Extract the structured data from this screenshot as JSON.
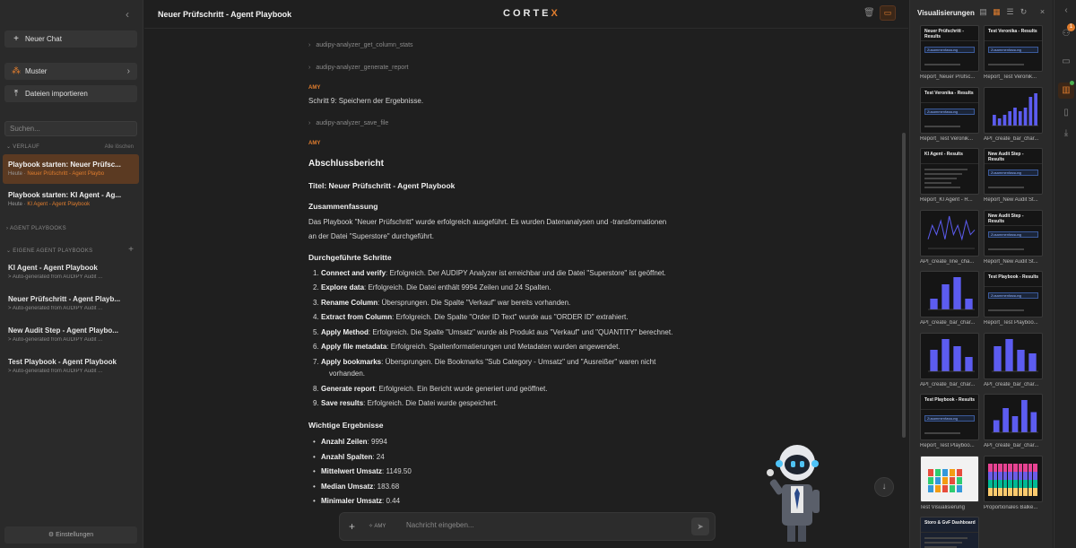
{
  "sidebar": {
    "new_chat": "Neuer Chat",
    "muster": "Muster",
    "import": "Dateien importieren",
    "search_placeholder": "Suchen...",
    "verlauf_label": "VERLAUF",
    "clear_all": "Alle löschen",
    "history": [
      {
        "title": "Playbook starten: Neuer Prüfsc...",
        "day": "Heute",
        "tag": "Neuer Prüfschritt - Agent Playbo"
      },
      {
        "title": "Playbook starten: KI Agent - Ag...",
        "day": "Heute",
        "tag": "KI Agent - Agent Playbook"
      }
    ],
    "agent_playbooks_label": "AGENT PLAYBOOKS",
    "own_playbooks_label": "EIGENE AGENT PLAYBOOKS",
    "playbooks": [
      {
        "title": "KI Agent - Agent Playbook",
        "sub": "> Auto-generated from AUDIPY Audit ..."
      },
      {
        "title": "Neuer Prüfschritt - Agent Playb...",
        "sub": "> Auto-generated from AUDIPY Audit ..."
      },
      {
        "title": "New Audit Step - Agent Playbo...",
        "sub": "> Auto-generated from AUDIPY Audit ..."
      },
      {
        "title": "Test Playbook - Agent Playbook",
        "sub": "> Auto-generated from AUDIPY Audit ..."
      }
    ],
    "settings": "Einstellungen"
  },
  "header": {
    "title": "Neuer Prüfschritt - Agent Playbook",
    "logo_a": "CORTE",
    "logo_b": "X"
  },
  "chat": {
    "tool1": "audipy-analyzer_get_column_stats",
    "tool2": "audipy-analyzer_generate_report",
    "amy": "AMY",
    "step9": "Schritt 9: Speichern der Ergebnisse.",
    "tool3": "audipy-analyzer_save_file",
    "report_heading": "Abschlussbericht",
    "report_title": "Titel: Neuer Prüfschritt - Agent Playbook",
    "summary_heading": "Zusammenfassung",
    "summary_line1": "Das Playbook \"Neuer Prüfschritt\" wurde erfolgreich ausgeführt. Es wurden Datenanalysen und -transformationen",
    "summary_line2": "an der Datei \"Superstore\" durchgeführt.",
    "steps_heading": "Durchgeführte Schritte",
    "steps": [
      {
        "n": "1.",
        "b": "Connect and verify",
        "t": ": Erfolgreich. Der AUDIPY Analyzer ist erreichbar und die Datei \"Superstore\" ist geöffnet."
      },
      {
        "n": "2.",
        "b": "Explore data",
        "t": ": Erfolgreich. Die Datei enthält 9994 Zeilen und 24 Spalten."
      },
      {
        "n": "3.",
        "b": "Rename Column",
        "t": ": Übersprungen. Die Spalte \"Verkauf\" war bereits vorhanden."
      },
      {
        "n": "4.",
        "b": "Extract from Column",
        "t": ": Erfolgreich. Die Spalte \"Order ID Text\" wurde aus \"ORDER ID\" extrahiert."
      },
      {
        "n": "5.",
        "b": "Apply Method",
        "t": ": Erfolgreich. Die Spalte \"Umsatz\" wurde als Produkt aus \"Verkauf\" und \"QUANTITY\" berechnet."
      },
      {
        "n": "6.",
        "b": "Apply file metadata",
        "t": ": Erfolgreich. Spaltenformatierungen und Metadaten wurden angewendet."
      },
      {
        "n": "7.",
        "b": "Apply bookmarks",
        "t": ": Übersprungen. Die Bookmarks \"Sub Category - Umsatz\" und \"Ausreißer\" waren nicht"
      },
      {
        "n": "",
        "b": "",
        "t": "vorhanden."
      },
      {
        "n": "8.",
        "b": "Generate report",
        "t": ": Erfolgreich. Ein Bericht wurde generiert und geöffnet."
      },
      {
        "n": "9.",
        "b": "Save results",
        "t": ": Erfolgreich. Die Datei wurde gespeichert."
      }
    ],
    "results_heading": "Wichtige Ergebnisse",
    "results": [
      {
        "b": "Anzahl Zeilen",
        "t": ": 9994"
      },
      {
        "b": "Anzahl Spalten",
        "t": ": 24"
      },
      {
        "b": "Mittelwert Umsatz",
        "t": ": 1149.50"
      },
      {
        "b": "Median Umsatz",
        "t": ": 183.68"
      },
      {
        "b": "Minimaler Umsatz",
        "t": ": 0.44"
      }
    ]
  },
  "composer": {
    "agent": "AMY",
    "placeholder": "Nachricht eingeben..."
  },
  "viz": {
    "title": "Visualisierungen",
    "items": [
      {
        "kind": "report",
        "cap": "Report_Neuer Prüfsc...",
        "title": "Neuer Prüfschritt - Results",
        "chip": "Zusammenfassung"
      },
      {
        "kind": "report",
        "cap": "Report_Test Veronik...",
        "title": "Test Veronika - Results",
        "chip": "Zusammenfassung"
      },
      {
        "kind": "report",
        "cap": "Report_Test Veronik...",
        "title": "Test Veronika - Results",
        "chip": "Zusammenfassung"
      },
      {
        "kind": "bar",
        "cap": "API_create_bar_char...",
        "vals": [
          3,
          2,
          3,
          4,
          5,
          4,
          5,
          8,
          9
        ]
      },
      {
        "kind": "report",
        "cap": "Report_KI Agent - R...",
        "title": "KI Agent - Results",
        "chip": ""
      },
      {
        "kind": "report",
        "cap": "Report_New Audit St...",
        "title": "New Audit Step - Results",
        "chip": "Zusammenfassung"
      },
      {
        "kind": "line",
        "cap": "API_create_line_cha...",
        "vals": [
          2,
          5,
          3,
          6,
          2,
          7,
          3,
          5,
          2,
          6,
          3,
          4
        ]
      },
      {
        "kind": "report",
        "cap": "Report_New Audit St...",
        "title": "New Audit Step - Results",
        "chip": "Zusammenfassung"
      },
      {
        "kind": "bar",
        "cap": "API_create_bar_char...",
        "vals": [
          3,
          7,
          9,
          3
        ]
      },
      {
        "kind": "report",
        "cap": "Report_Test Playboo...",
        "title": "Test Playbook - Results",
        "chip": "Zusammenfassung"
      },
      {
        "kind": "bar",
        "cap": "API_create_bar_char...",
        "vals": [
          6,
          9,
          7,
          4
        ]
      },
      {
        "kind": "bar",
        "cap": "API_create_bar_char...",
        "vals": [
          7,
          9,
          6,
          5
        ]
      },
      {
        "kind": "report",
        "cap": "Report_Test Playboo...",
        "title": "Test Playbook - Results",
        "chip": "Zusammenfassung"
      },
      {
        "kind": "bar",
        "cap": "API_create_bar_char...",
        "vals": [
          3,
          6,
          4,
          8,
          5
        ]
      },
      {
        "kind": "light",
        "cap": "Test Visualisierung"
      },
      {
        "kind": "stacked",
        "cap": "Proportionales Balke..."
      },
      {
        "kind": "dash",
        "cap": "",
        "title": "Storo & GvF Dashboard"
      }
    ]
  },
  "rail": {
    "badge": "1"
  }
}
